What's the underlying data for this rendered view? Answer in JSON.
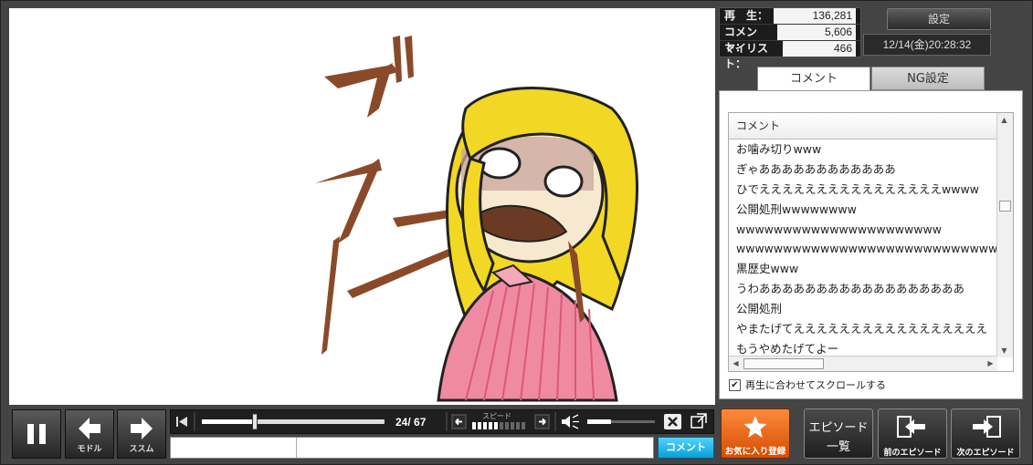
{
  "stats": {
    "play_label": "再　生：",
    "play_value": "136,281",
    "comment_label": "コメント：",
    "comment_value": "5,606",
    "mylist_label": "マイリスト：",
    "mylist_value": "466"
  },
  "settings_label": "設定",
  "datetime": "12/14(金)20:28:32",
  "tabs": {
    "comment": "コメント",
    "ng": "NG設定"
  },
  "comment_list": {
    "header": "コメント",
    "rows": [
      "お噛み切りwww",
      "ぎゃああああああああああああ",
      "ひでええええええええええええええええwwww",
      "公開処刑wwwwwwww",
      "wwwwwwwwwwwwwwwwwwwwww",
      "wwwwwwwwwwwwwwwwwwwwwwwwwwwwwwww",
      "黒歴史www",
      "うわああああああああああああああああああ",
      "公開処刑",
      "やまたげてえええええええええええええええええ",
      "もうやめたげてよー"
    ]
  },
  "scroll_sync_label": "再生に合わせてスクロールする",
  "scroll_sync_checked": true,
  "player": {
    "back_label": "モドル",
    "forward_label": "ススム",
    "time_text": "24/ 67",
    "speed_label": "スピード",
    "progress": 0.29,
    "volume": 0.35
  },
  "comment_send_label": "コメント",
  "favorite_label": "お気に入り登録",
  "episode_list_label_1": "エピソード",
  "episode_list_label_2": "一覧",
  "prev_episode_label": "前のエピソード",
  "next_episode_label": "次のエピソード",
  "video": {
    "sfx_text": "ブフ!",
    "colors": {
      "hair": "#f2d825",
      "shirt": "#f08aa0",
      "sfx": "#8a4a2a"
    }
  }
}
